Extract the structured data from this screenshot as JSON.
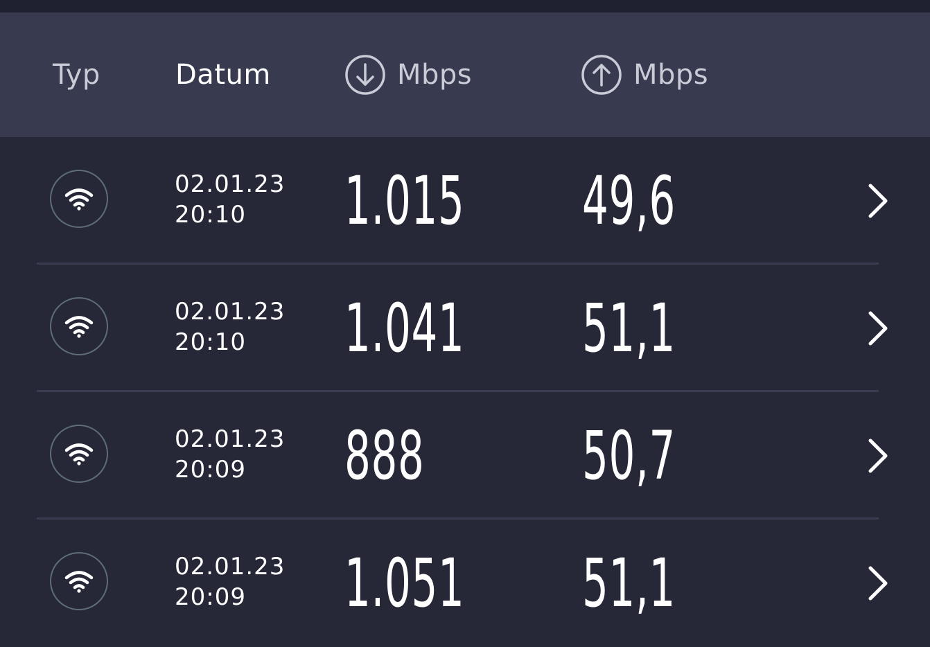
{
  "header": {
    "typ_label": "Typ",
    "datum_label": "Datum",
    "download_unit": "Mbps",
    "upload_unit": "Mbps",
    "download_icon": "arrow-down-circle-icon",
    "upload_icon": "arrow-up-circle-icon"
  },
  "results": [
    {
      "type_icon": "wifi-icon",
      "date": "02.01.23",
      "time": "20:10",
      "download": "1.015",
      "upload": "49,6"
    },
    {
      "type_icon": "wifi-icon",
      "date": "02.01.23",
      "time": "20:10",
      "download": "1.041",
      "upload": "51,1"
    },
    {
      "type_icon": "wifi-icon",
      "date": "02.01.23",
      "time": "20:09",
      "download": "888",
      "upload": "50,7"
    },
    {
      "type_icon": "wifi-icon",
      "date": "02.01.23",
      "time": "20:09",
      "download": "1.051",
      "upload": "51,1"
    }
  ],
  "colors": {
    "background": "#262838",
    "header_background": "#383a4f",
    "divider": "#3a3c50",
    "icon_ring": "#5f6d78",
    "text": "#ffffff",
    "muted_text": "#c9cbd6"
  }
}
